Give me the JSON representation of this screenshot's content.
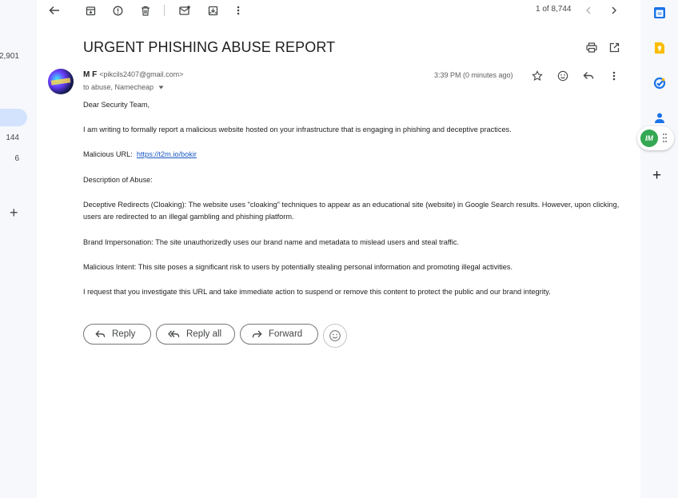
{
  "left_rail": {
    "count_top": "2,901",
    "count_mid": "144",
    "count_low": "6",
    "add_label": "+"
  },
  "toolbar": {
    "pager_text": "1 of 8,744"
  },
  "email": {
    "subject": "URGENT PHISHING ABUSE REPORT",
    "sender_name": "M F",
    "sender_email": "<pikcils2407@gmail.com>",
    "to_line": "to abuse, Namecheap",
    "time": "3:39 PM (0 minutes ago)",
    "body": {
      "greeting": "Dear Security Team,",
      "p1": "I am writing to formally report a malicious website hosted on your infrastructure that is engaging in phishing and deceptive practices.",
      "url_label": "Malicious URL:",
      "url": "https://t2m.io/bokir",
      "desc_heading": "Description of Abuse:",
      "p2": "Deceptive Redirects (Cloaking): The website uses \"cloaking\" techniques to appear as an educational site (website) in Google Search results. However, upon clicking, users are redirected to an illegal gambling and phishing platform.",
      "p3": "Brand Impersonation: The site unauthorizedly uses our brand name and metadata to mislead users and steal traffic.",
      "p4": "Malicious Intent: This site poses a significant risk to users by potentially stealing personal information and promoting illegal activities.",
      "p5": "I request that you investigate this URL and take immediate action to suspend or remove this content to protect the public and our brand integrity."
    }
  },
  "actions": {
    "reply": "Reply",
    "reply_all": "Reply all",
    "forward": "Forward"
  },
  "right_rail": {
    "app_badge": "IM",
    "add_label": "+"
  },
  "colors": {
    "link": "#1a58c4",
    "rail_selected": "#d3e3fd",
    "calendar": "#1a73e8",
    "keep": "#fbbc04",
    "tasks": "#1a73e8",
    "app_badge_bg": "#34a853"
  }
}
